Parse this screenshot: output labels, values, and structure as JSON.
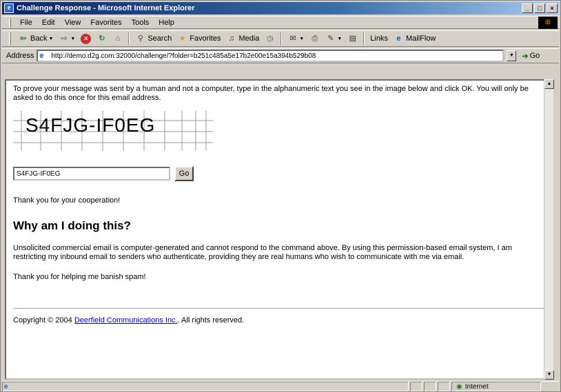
{
  "window": {
    "title": "Challenge Response - Microsoft Internet Explorer",
    "controls": [
      "_",
      "□",
      "×"
    ]
  },
  "menu": [
    "File",
    "Edit",
    "View",
    "Favorites",
    "Tools",
    "Help"
  ],
  "toolbar": {
    "back": "Back",
    "search": "Search",
    "favorites": "Favorites",
    "media": "Media",
    "links": "Links",
    "mailflow": "MailFlow"
  },
  "address": {
    "label": "Address",
    "url": "http://demo.d2g.com:32000/challenge/?folder=b251c485a5e17b2e00e15a394b529b08",
    "go": "Go"
  },
  "page": {
    "intro": "To prove your message was sent by a human and not a computer, type in the alphanumeric text you see in the image below and click OK. You will only be asked to do this once for this email address.",
    "captcha_code": "S4FJG-IF0EG",
    "input_value": "S4FJG-IF0EG",
    "submit_label": "Go",
    "thanks": "Thank you for your cooperation!",
    "heading": "Why am I doing this?",
    "explanation": "Unsolicited commercial email is computer-generated and cannot respond to the command above. By using this permission-based email system, I am restricting my inbound email to senders who authenticate, providing they are real humans who wish to communicate with me via email.",
    "banish": "Thank you for helping me banish spam!",
    "copyright_prefix": "Copyright © 2004",
    "copyright_link": "Deerfield Communications Inc.",
    "copyright_suffix": ". All rights reserved."
  },
  "status": {
    "zone": "Internet"
  }
}
